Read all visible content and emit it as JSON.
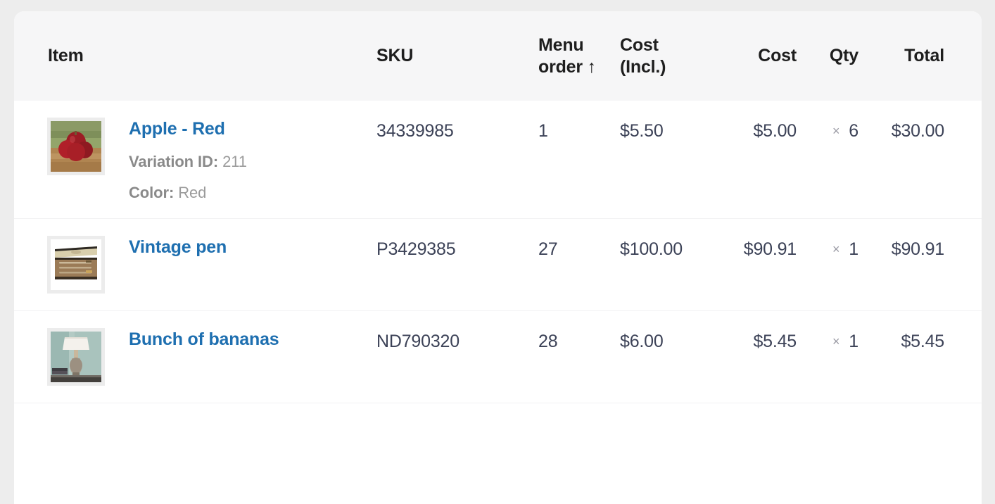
{
  "table": {
    "columns": [
      {
        "key": "item",
        "label": "Item",
        "label_line2": "",
        "align": "left"
      },
      {
        "key": "sku",
        "label": "SKU",
        "label_line2": "",
        "align": "left"
      },
      {
        "key": "menu_order",
        "label": "Menu",
        "label_line2": "order ↑",
        "align": "left",
        "sorted": "asc",
        "sort_icon": "arrow-up-icon"
      },
      {
        "key": "cost_incl",
        "label": "Cost",
        "label_line2": "(Incl.)",
        "align": "left"
      },
      {
        "key": "cost",
        "label": "Cost",
        "label_line2": "",
        "align": "right"
      },
      {
        "key": "qty",
        "label": "Qty",
        "label_line2": "",
        "align": "right"
      },
      {
        "key": "total",
        "label": "Total",
        "label_line2": "",
        "align": "right"
      }
    ],
    "rows": [
      {
        "name": "Apple - Red",
        "thumbnail": "apples-on-wooden-board-photo",
        "meta": [
          {
            "label": "Variation ID:",
            "value": "211"
          },
          {
            "label": "Color:",
            "value": "Red"
          }
        ],
        "sku": "34339985",
        "menu_order": "1",
        "cost_incl": "$5.50",
        "cost": "$5.00",
        "qty_symbol": "×",
        "qty": "6",
        "total": "$30.00"
      },
      {
        "name": "Vintage pen",
        "thumbnail": "vintage-pen-set-in-case-photo",
        "meta": [],
        "sku": "P3429385",
        "menu_order": "27",
        "cost_incl": "$100.00",
        "cost": "$90.91",
        "qty_symbol": "×",
        "qty": "1",
        "total": "$90.91"
      },
      {
        "name": "Bunch of bananas",
        "thumbnail": "table-lamp-photo",
        "meta": [],
        "sku": "ND790320",
        "menu_order": "28",
        "cost_incl": "$6.00",
        "cost": "$5.45",
        "qty_symbol": "×",
        "qty": "1",
        "total": "$5.45"
      }
    ]
  },
  "colors": {
    "link": "#1e6fb0",
    "header_bg": "#f6f6f7",
    "card_bg": "#ffffff",
    "page_bg": "#ededed",
    "text": "#3c4257",
    "meta_label": "#8a8a8a",
    "meta_value": "#9b9b9b",
    "divider": "#f2f2f3"
  }
}
